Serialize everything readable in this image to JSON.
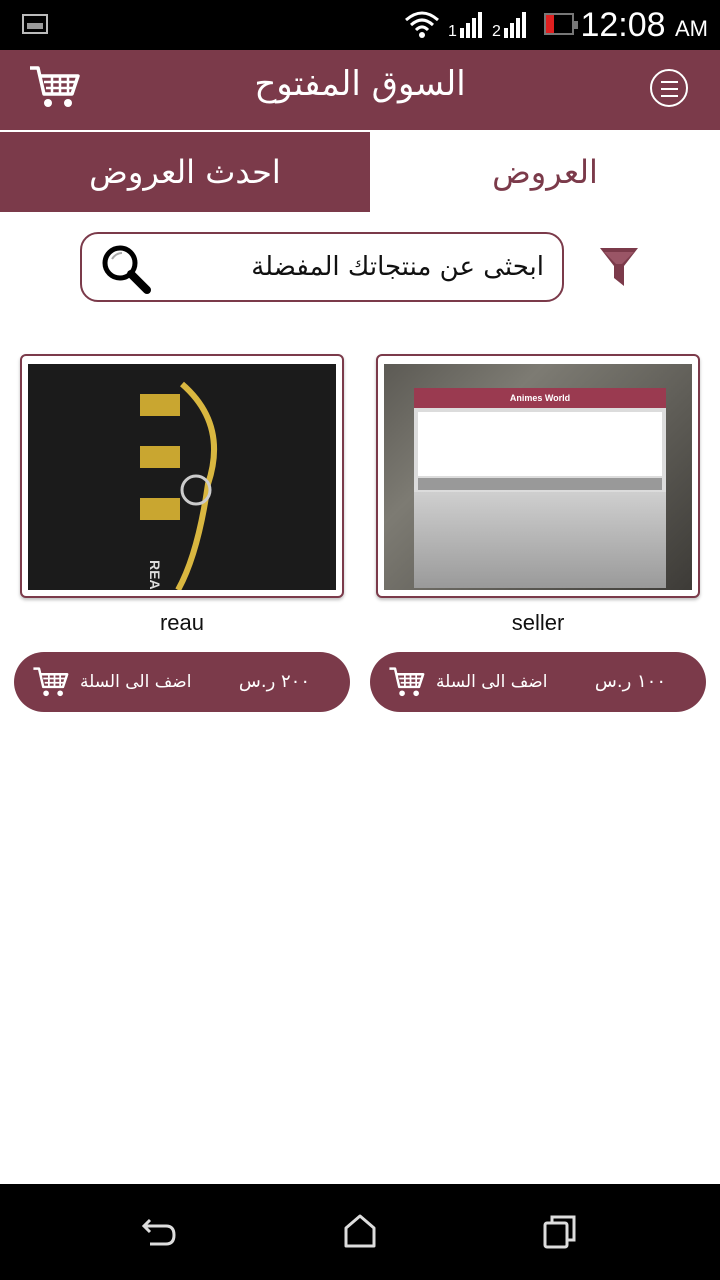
{
  "status_bar": {
    "time": "12:08",
    "ampm": "AM",
    "sim1": "1",
    "sim2": "2"
  },
  "app_bar": {
    "title": "السوق المفتوح",
    "menu_icon": "menu-icon",
    "cart_icon": "cart-icon"
  },
  "tabs": [
    {
      "label": "العروض",
      "selected": true
    },
    {
      "label": "احدث العروض",
      "selected": false
    }
  ],
  "search": {
    "placeholder": "ابحثى عن منتجاتك المفضلة",
    "icon": "search-icon",
    "filter_icon": "filter-icon"
  },
  "products": [
    {
      "name": "seller",
      "price": "١٠٠ ر.س",
      "add_label": "اضف الى السلة",
      "image_caption": "Animes World"
    },
    {
      "name": "reau",
      "price": "٢٠٠ ر.س",
      "add_label": "اضف الى السلة",
      "image_caption": "READY"
    }
  ],
  "colors": {
    "primary": "#7b3a4a",
    "background": "#ffffff"
  }
}
